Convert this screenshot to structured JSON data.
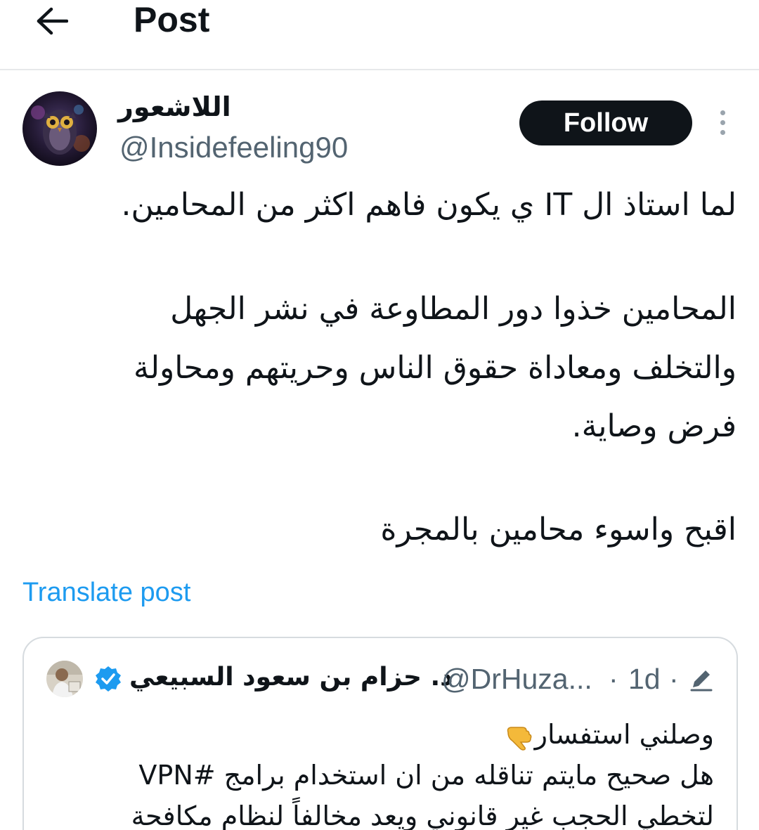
{
  "header": {
    "title": "Post"
  },
  "author": {
    "display_name": "اللاشعور",
    "handle": "@Insidefeeling90",
    "follow_label": "Follow"
  },
  "post": {
    "lines": [
      "لما استاذ ال IT ي  يكون فاهم اكثر من المحامين.",
      "المحامين خذوا دور المطاوعة في نشر الجهل",
      "والتخلف ومعاداة حقوق الناس وحريتهم ومحاولة",
      "فرض وصاية.",
      "اقبح واسوء محامين بالمجرة"
    ],
    "translate_label": "Translate post"
  },
  "quoted_post": {
    "display_name": "د. حزام بن سعود السبيعي",
    "handle": "@DrHuza...",
    "separator": "·",
    "time": "1d",
    "lines": [
      "وصلني استفسار",
      "هل صحيح مايتم تناقله من ان استخدام برامج #VPN",
      "لتخطي الحجب غير قانوني ويعد مخالفاً لنظام مكافحة"
    ]
  },
  "colors": {
    "accent": "#1d9bf0",
    "text_primary": "#0f1419",
    "text_secondary": "#536471",
    "border": "#e6e8ea"
  },
  "icons": {
    "back": "arrow-left-icon",
    "more": "more-vertical-icon",
    "verified": "verified-badge-icon",
    "edited": "pencil-icon",
    "emoji": "backhand-index-pointing-down-emoji"
  }
}
